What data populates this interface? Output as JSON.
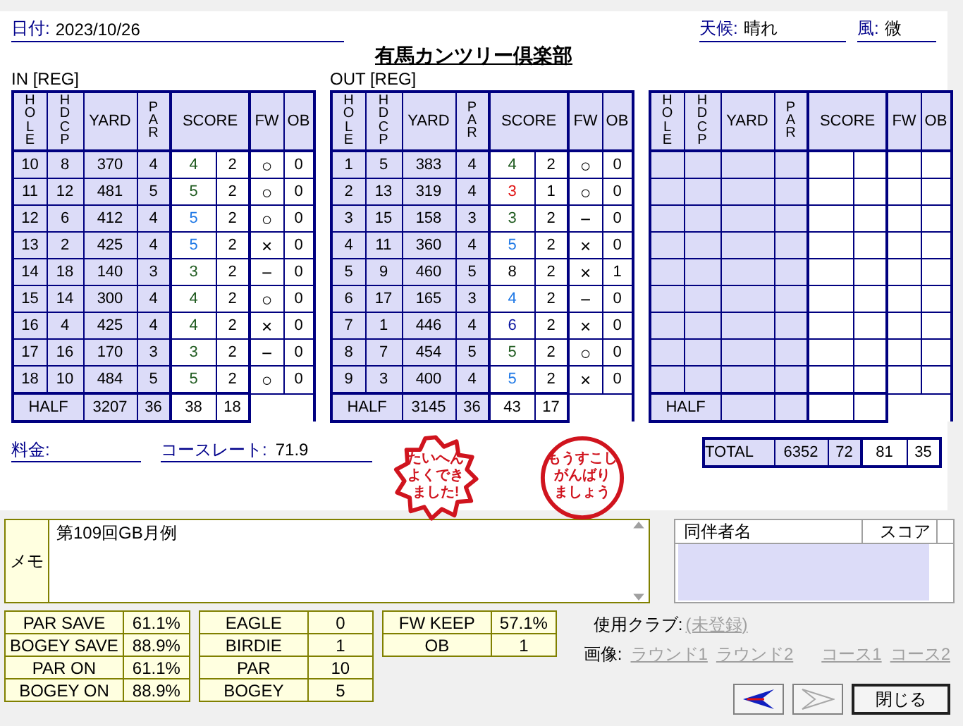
{
  "header": {
    "date_label": "日付:",
    "date": "2023/10/26",
    "weather_label": "天候:",
    "weather": "晴れ",
    "wind_label": "風:",
    "wind": "微"
  },
  "course_name": "有馬カンツリー倶楽部",
  "cards": [
    {
      "title": "IN [REG]",
      "columns": [
        "HOLE",
        "HDCP",
        "YARD",
        "PAR",
        "SCORE",
        "FW",
        "OB"
      ],
      "rows": [
        {
          "hole": "10",
          "hdcp": "8",
          "yard": "370",
          "par": "4",
          "score": "4",
          "putts": "2",
          "fw": "○",
          "ob": "0",
          "color": "#1e5a1e"
        },
        {
          "hole": "11",
          "hdcp": "12",
          "yard": "481",
          "par": "5",
          "score": "5",
          "putts": "2",
          "fw": "○",
          "ob": "0",
          "color": "#1e5a1e"
        },
        {
          "hole": "12",
          "hdcp": "6",
          "yard": "412",
          "par": "4",
          "score": "5",
          "putts": "2",
          "fw": "○",
          "ob": "0",
          "color": "#1e78e6"
        },
        {
          "hole": "13",
          "hdcp": "2",
          "yard": "425",
          "par": "4",
          "score": "5",
          "putts": "2",
          "fw": "×",
          "ob": "0",
          "color": "#1e78e6"
        },
        {
          "hole": "14",
          "hdcp": "18",
          "yard": "140",
          "par": "3",
          "score": "3",
          "putts": "2",
          "fw": "−",
          "ob": "0",
          "color": "#1e5a1e"
        },
        {
          "hole": "15",
          "hdcp": "14",
          "yard": "300",
          "par": "4",
          "score": "4",
          "putts": "2",
          "fw": "○",
          "ob": "0",
          "color": "#1e5a1e"
        },
        {
          "hole": "16",
          "hdcp": "4",
          "yard": "425",
          "par": "4",
          "score": "4",
          "putts": "2",
          "fw": "×",
          "ob": "0",
          "color": "#1e5a1e"
        },
        {
          "hole": "17",
          "hdcp": "16",
          "yard": "170",
          "par": "3",
          "score": "3",
          "putts": "2",
          "fw": "−",
          "ob": "0",
          "color": "#1e5a1e"
        },
        {
          "hole": "18",
          "hdcp": "10",
          "yard": "484",
          "par": "5",
          "score": "5",
          "putts": "2",
          "fw": "○",
          "ob": "0",
          "color": "#1e5a1e"
        }
      ],
      "half": {
        "label": "HALF",
        "yard": "3207",
        "par": "36",
        "score": "38",
        "putts": "18"
      }
    },
    {
      "title": "OUT [REG]",
      "columns": [
        "HOLE",
        "HDCP",
        "YARD",
        "PAR",
        "SCORE",
        "FW",
        "OB"
      ],
      "rows": [
        {
          "hole": "1",
          "hdcp": "5",
          "yard": "383",
          "par": "4",
          "score": "4",
          "putts": "2",
          "fw": "○",
          "ob": "0",
          "color": "#1e5a1e"
        },
        {
          "hole": "2",
          "hdcp": "13",
          "yard": "319",
          "par": "4",
          "score": "3",
          "putts": "1",
          "fw": "○",
          "ob": "0",
          "color": "#e01010"
        },
        {
          "hole": "3",
          "hdcp": "15",
          "yard": "158",
          "par": "3",
          "score": "3",
          "putts": "2",
          "fw": "−",
          "ob": "0",
          "color": "#1e5a1e"
        },
        {
          "hole": "4",
          "hdcp": "11",
          "yard": "360",
          "par": "4",
          "score": "5",
          "putts": "2",
          "fw": "×",
          "ob": "0",
          "color": "#1e78e6"
        },
        {
          "hole": "5",
          "hdcp": "9",
          "yard": "460",
          "par": "5",
          "score": "8",
          "putts": "2",
          "fw": "×",
          "ob": "1",
          "color": "#000000"
        },
        {
          "hole": "6",
          "hdcp": "17",
          "yard": "165",
          "par": "3",
          "score": "4",
          "putts": "2",
          "fw": "−",
          "ob": "0",
          "color": "#1e78e6"
        },
        {
          "hole": "7",
          "hdcp": "1",
          "yard": "446",
          "par": "4",
          "score": "6",
          "putts": "2",
          "fw": "×",
          "ob": "0",
          "color": "#0a14a0"
        },
        {
          "hole": "8",
          "hdcp": "7",
          "yard": "454",
          "par": "5",
          "score": "5",
          "putts": "2",
          "fw": "○",
          "ob": "0",
          "color": "#1e5a1e"
        },
        {
          "hole": "9",
          "hdcp": "3",
          "yard": "400",
          "par": "4",
          "score": "5",
          "putts": "2",
          "fw": "×",
          "ob": "0",
          "color": "#1e78e6"
        }
      ],
      "half": {
        "label": "HALF",
        "yard": "3145",
        "par": "36",
        "score": "43",
        "putts": "17"
      }
    },
    {
      "columns": [
        "HOLE",
        "HDCP",
        "YARD",
        "PAR",
        "SCORE",
        "FW",
        "OB"
      ],
      "half": {
        "label": "HALF"
      },
      "total": {
        "label": "TOTAL",
        "yard": "6352",
        "par": "72",
        "score": "81",
        "putts": "35"
      }
    }
  ],
  "fee": {
    "label": "料金:"
  },
  "course_rate": {
    "label": "コースレート:",
    "value": "71.9"
  },
  "stamps": [
    {
      "kind": "burst",
      "lines": [
        "たいへん",
        "よくでき",
        "ました!"
      ]
    },
    {
      "kind": "circle",
      "lines": [
        "もうすこし",
        "がんばり",
        "ましょう"
      ]
    }
  ],
  "memo": {
    "label": "メモ",
    "text": "第109回GB月例"
  },
  "companions": {
    "columns": [
      "同伴者名",
      "スコア"
    ]
  },
  "stats": [
    [
      {
        "label": "PAR SAVE",
        "value": "61.1%"
      },
      {
        "label": "BOGEY SAVE",
        "value": "88.9%"
      },
      {
        "label": "PAR ON",
        "value": "61.1%"
      },
      {
        "label": "BOGEY ON",
        "value": "88.9%"
      }
    ],
    [
      {
        "label": "EAGLE",
        "value": "0"
      },
      {
        "label": "BIRDIE",
        "value": "1"
      },
      {
        "label": "PAR",
        "value": "10"
      },
      {
        "label": "BOGEY",
        "value": "5"
      }
    ],
    [
      {
        "label": "FW KEEP",
        "value": "57.1%"
      },
      {
        "label": "OB",
        "value": "1"
      }
    ]
  ],
  "club": {
    "label": "使用クラブ:",
    "link": "(未登録)"
  },
  "images": {
    "label": "画像:",
    "links": [
      "ラウンド1",
      "ラウンド2",
      "コース1",
      "コース2"
    ]
  },
  "nav": {
    "back_disabled": false,
    "forward_disabled": true
  },
  "close_button": "閉じる"
}
